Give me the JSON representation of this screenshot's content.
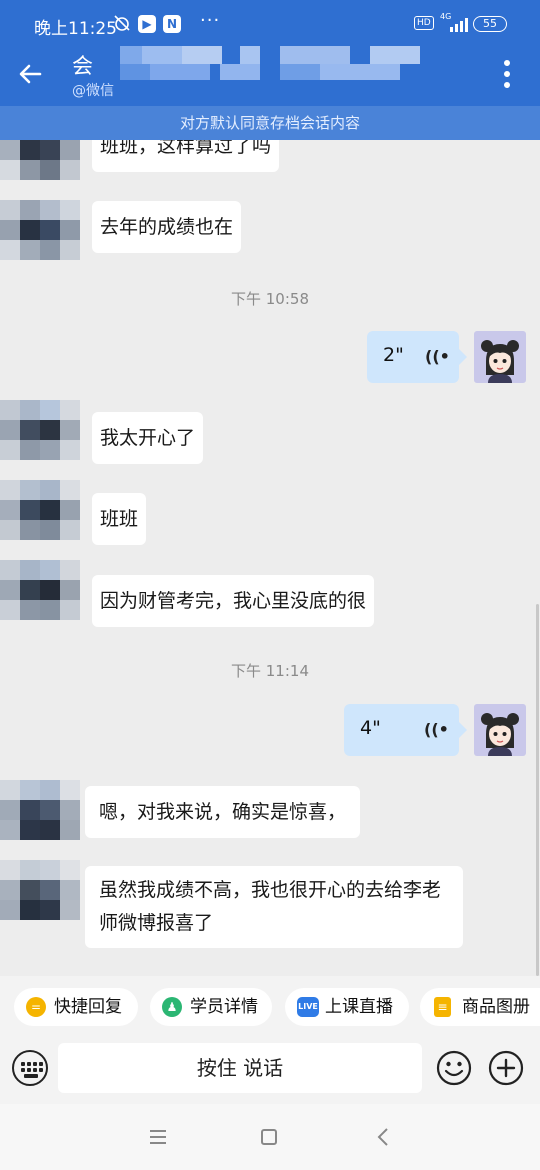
{
  "status_bar": {
    "time": "晚上11:25",
    "network": "4G",
    "battery": "55",
    "hd": "HD",
    "more_glyph": "···"
  },
  "header": {
    "title": "会",
    "subtitle": "@微信",
    "archive_notice": "对方默认同意存档会话内容"
  },
  "messages": [
    {
      "side": "in",
      "text": "班班，这样算过了吗"
    },
    {
      "side": "in",
      "text": "去年的成绩也在"
    },
    {
      "type": "time",
      "text": "下午 10:58"
    },
    {
      "side": "out",
      "voice_duration": "2\""
    },
    {
      "side": "in",
      "text": "我太开心了"
    },
    {
      "side": "in",
      "text": "班班"
    },
    {
      "side": "in",
      "text": "因为财管考完，我心里没底的很"
    },
    {
      "type": "time",
      "text": "下午 11:14"
    },
    {
      "side": "out",
      "voice_duration": "4\""
    },
    {
      "side": "in",
      "text": "嗯，对我来说，确实是惊喜，"
    },
    {
      "side": "in",
      "text": "虽然我成绩不高，我也很开心的去给李老师微博报喜了"
    }
  ],
  "quick_actions": [
    {
      "label": "快捷回复",
      "icon": "quick-reply-icon",
      "color": "#f5b400"
    },
    {
      "label": "学员详情",
      "icon": "student-icon",
      "color": "#2bb673"
    },
    {
      "label": "上课直播",
      "icon": "live-icon",
      "color": "#2f7be6"
    },
    {
      "label": "商品图册",
      "icon": "catalog-icon",
      "color": "#f5b400"
    }
  ],
  "input": {
    "hold_to_talk": "按住 说话"
  },
  "icons": {
    "live_badge": "LIVE"
  },
  "colors": {
    "header_blue": "#2f6fd1",
    "outgoing_bubble": "#cfe6fc",
    "background": "#ededed"
  }
}
